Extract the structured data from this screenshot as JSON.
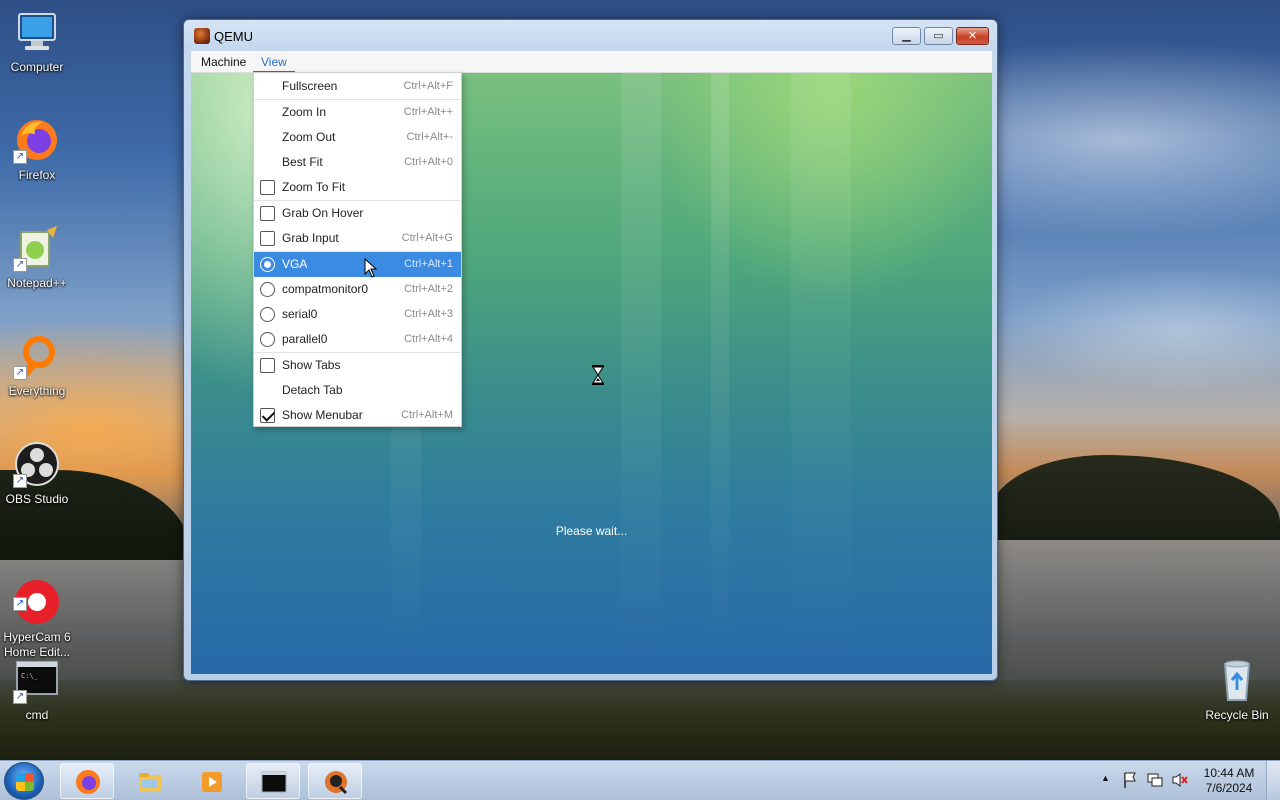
{
  "desktop": {
    "icons": [
      {
        "label": "Computer"
      },
      {
        "label": "Firefox"
      },
      {
        "label": "Notepad++"
      },
      {
        "label": "Everything"
      },
      {
        "label": "OBS Studio"
      },
      {
        "label": "HyperCam 6\nHome Edit..."
      },
      {
        "label": "cmd"
      },
      {
        "label": "Recycle Bin"
      }
    ]
  },
  "window": {
    "title": "QEMU",
    "menubar": [
      {
        "label": "Machine"
      },
      {
        "label": "View"
      }
    ],
    "guest_status": "Please wait..."
  },
  "view_menu": {
    "items": [
      {
        "label": "Fullscreen",
        "shortcut": "Ctrl+Alt+F"
      },
      {
        "label": "Zoom In",
        "shortcut": "Ctrl+Alt++"
      },
      {
        "label": "Zoom Out",
        "shortcut": "Ctrl+Alt+-"
      },
      {
        "label": "Best Fit",
        "shortcut": "Ctrl+Alt+0"
      },
      {
        "label": "Zoom To Fit",
        "shortcut": ""
      },
      {
        "label": "Grab On Hover",
        "shortcut": ""
      },
      {
        "label": "Grab Input",
        "shortcut": "Ctrl+Alt+G"
      },
      {
        "label": "VGA",
        "shortcut": "Ctrl+Alt+1"
      },
      {
        "label": "compatmonitor0",
        "shortcut": "Ctrl+Alt+2"
      },
      {
        "label": "serial0",
        "shortcut": "Ctrl+Alt+3"
      },
      {
        "label": "parallel0",
        "shortcut": "Ctrl+Alt+4"
      },
      {
        "label": "Show Tabs",
        "shortcut": ""
      },
      {
        "label": "Detach Tab",
        "shortcut": ""
      },
      {
        "label": "Show Menubar",
        "shortcut": "Ctrl+Alt+M"
      }
    ],
    "states": {
      "zoom_to_fit": false,
      "grab_on_hover": false,
      "grab_input": false,
      "selected_console": "VGA",
      "show_tabs": false,
      "show_menubar": true
    }
  },
  "taskbar": {
    "clock_time": "10:44 AM",
    "clock_date": "7/6/2024",
    "tray_expand": "▲"
  },
  "colors": {
    "menu_highlight": "#3b8be3",
    "menu_active": "#2a6fc9"
  }
}
